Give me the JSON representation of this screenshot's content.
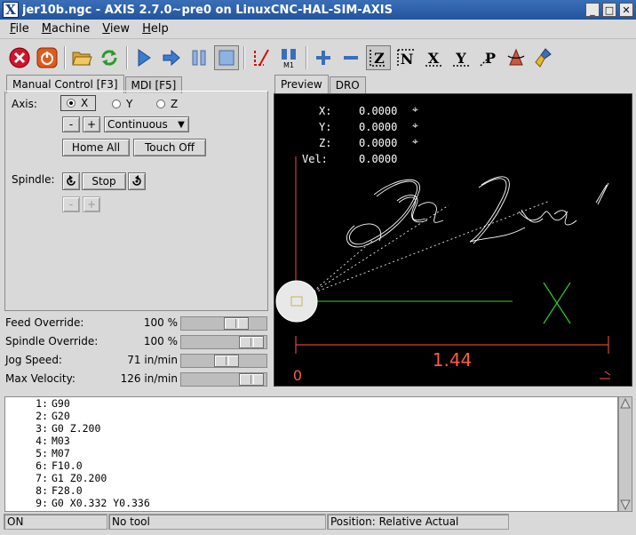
{
  "window": {
    "title": "jer10b.ngc - AXIS 2.7.0~pre0 on LinuxCNC-HAL-SIM-AXIS",
    "app_icon": "X"
  },
  "window_buttons": [
    "_",
    "□",
    "✕"
  ],
  "menu": [
    {
      "label": "File",
      "u": "F",
      "rest": "ile"
    },
    {
      "label": "Machine",
      "u": "M",
      "rest": "achine"
    },
    {
      "label": "View",
      "u": "V",
      "rest": "iew"
    },
    {
      "label": "Help",
      "u": "H",
      "rest": "elp"
    }
  ],
  "toolbar_icons": [
    "estop-icon",
    "power-icon",
    "open-folder-icon",
    "reload-icon",
    "run-icon",
    "step-icon",
    "pause-icon",
    "stop-icon",
    "block-delete-icon",
    "optional-stop-icon",
    "zoom-in-icon",
    "zoom-out-icon",
    "view-z-icon",
    "view-z2-icon",
    "view-x-icon",
    "view-y-icon",
    "view-p-icon",
    "rotate-icon",
    "clear-plot-icon"
  ],
  "left_tabs": {
    "manual": "Manual Control [F3]",
    "mdi": "MDI [F5]"
  },
  "manual": {
    "axis_label": "Axis:",
    "axes": [
      "X",
      "Y",
      "Z"
    ],
    "selected_axis": "X",
    "minus": "-",
    "plus": "+",
    "jog_mode": "Continuous",
    "home_all": "Home All",
    "touch_off": "Touch Off",
    "spindle_label": "Spindle:",
    "spindle_stop": "Stop",
    "spindle_minus": "-",
    "spindle_plus": "+"
  },
  "overrides": {
    "feed": {
      "name": "Feed Override:",
      "value": "100 %",
      "level": 0.7
    },
    "spindle": {
      "name": "Spindle Override:",
      "value": "100 %",
      "level": 0.95
    },
    "jog": {
      "name": "Jog Speed:",
      "value": "71 in/min",
      "level": 0.55
    },
    "maxvel": {
      "name": "Max Velocity:",
      "value": "126 in/min",
      "level": 0.95
    }
  },
  "right_tabs": {
    "preview": "Preview",
    "dro": "DRO"
  },
  "dro": {
    "x_label": "X:",
    "x_value": "0.0000",
    "y_label": "Y:",
    "y_value": "0.0000",
    "z_label": "Z:",
    "z_value": "0.0000",
    "vel_label": "Vel:",
    "vel_value": "0.0000"
  },
  "preview": {
    "signature_text": "Jer Lue'",
    "dimension": "1.44",
    "origin_mark": "0",
    "colors": {
      "trace": "#ffffff",
      "feed": "#ffffff",
      "axis_x": "#ff4040",
      "green": "#33cc33",
      "dimension": "#ff5a40"
    }
  },
  "gcode": [
    {
      "num": "1:",
      "code": "G90"
    },
    {
      "num": "2:",
      "code": "G20"
    },
    {
      "num": "3:",
      "code": "G0 Z.200"
    },
    {
      "num": "4:",
      "code": "M03"
    },
    {
      "num": "5:",
      "code": "M07"
    },
    {
      "num": "6:",
      "code": "F10.0"
    },
    {
      "num": "7:",
      "code": "G1 Z0.200"
    },
    {
      "num": "8:",
      "code": "F28.0"
    },
    {
      "num": "9:",
      "code": "G0 X0.332 Y0.336"
    }
  ],
  "status": {
    "state": "ON",
    "tool": "No tool",
    "position": "Position: Relative Actual"
  }
}
